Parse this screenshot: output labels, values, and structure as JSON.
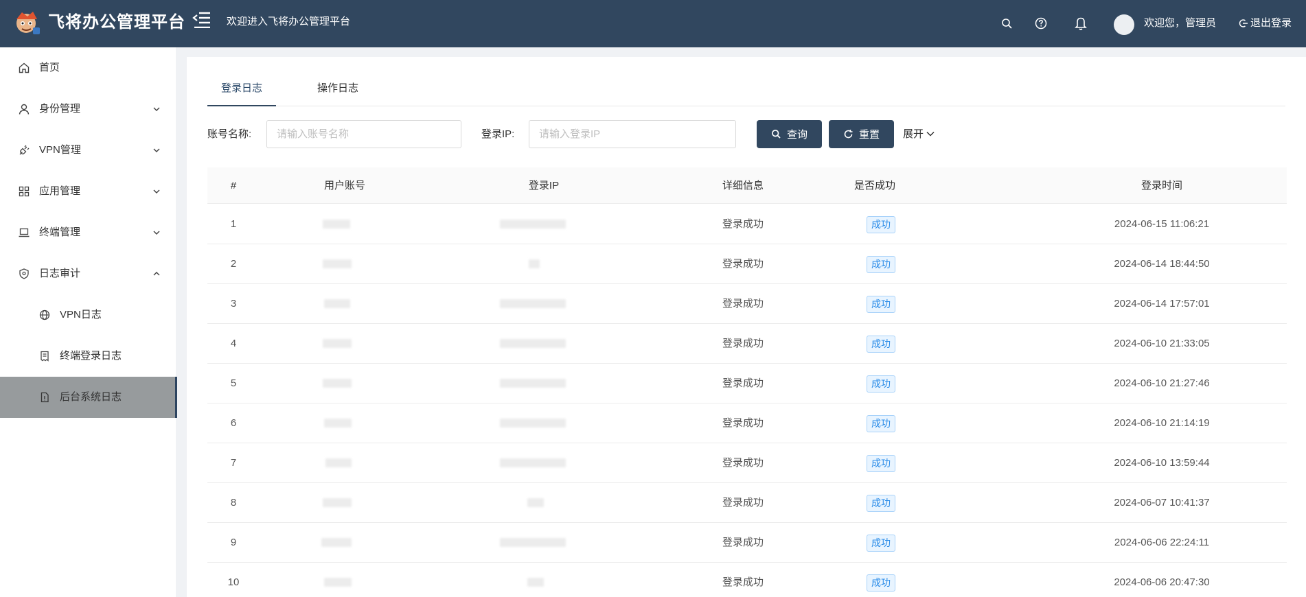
{
  "header": {
    "brand": "飞将办公管理平台",
    "welcome": "欢迎进入飞将办公管理平台",
    "user_greeting": "欢迎您，管理员",
    "logout_label": "退出登录",
    "bg_color": "#31475f"
  },
  "sidebar": {
    "items": [
      {
        "label": "首页",
        "icon": "home-icon"
      },
      {
        "label": "身份管理",
        "icon": "user-icon",
        "expandable": true,
        "expanded": false
      },
      {
        "label": "VPN管理",
        "icon": "plug-icon",
        "expandable": true,
        "expanded": false
      },
      {
        "label": "应用管理",
        "icon": "grid-icon",
        "expandable": true,
        "expanded": false
      },
      {
        "label": "终端管理",
        "icon": "laptop-icon",
        "expandable": true,
        "expanded": false
      },
      {
        "label": "日志审计",
        "icon": "shield-icon",
        "expandable": true,
        "expanded": true
      },
      {
        "label": "VPN日志",
        "icon": "globe-icon",
        "sub": true
      },
      {
        "label": "终端登录日志",
        "icon": "receipt-icon",
        "sub": true
      },
      {
        "label": "后台系统日志",
        "icon": "file-icon",
        "sub": true,
        "active": true
      }
    ]
  },
  "tabs": [
    "登录日志",
    "操作日志"
  ],
  "active_tab": "登录日志",
  "filters": {
    "account_label": "账号名称:",
    "account_placeholder": "请输入账号名称",
    "ip_label": "登录IP:",
    "ip_placeholder": "请输入登录IP",
    "search_label": "查询",
    "reset_label": "重置",
    "expand_label": "展开"
  },
  "table": {
    "columns": [
      "#",
      "用户账号",
      "登录IP",
      "详细信息",
      "是否成功",
      "登录时间"
    ],
    "rows": [
      {
        "idx": "1",
        "detail": "登录成功",
        "success": "成功",
        "time": "2024-06-15 11:06:21"
      },
      {
        "idx": "2",
        "detail": "登录成功",
        "success": "成功",
        "time": "2024-06-14 18:44:50"
      },
      {
        "idx": "3",
        "detail": "登录成功",
        "success": "成功",
        "time": "2024-06-14 17:57:01"
      },
      {
        "idx": "4",
        "detail": "登录成功",
        "success": "成功",
        "time": "2024-06-10 21:33:05"
      },
      {
        "idx": "5",
        "detail": "登录成功",
        "success": "成功",
        "time": "2024-06-10 21:27:46"
      },
      {
        "idx": "6",
        "detail": "登录成功",
        "success": "成功",
        "time": "2024-06-10 21:14:19"
      },
      {
        "idx": "7",
        "detail": "登录成功",
        "success": "成功",
        "time": "2024-06-10 13:59:44"
      },
      {
        "idx": "8",
        "detail": "登录成功",
        "success": "成功",
        "time": "2024-06-07 10:41:37"
      },
      {
        "idx": "9",
        "detail": "登录成功",
        "success": "成功",
        "time": "2024-06-06 22:24:11"
      },
      {
        "idx": "10",
        "detail": "登录成功",
        "success": "成功",
        "time": "2024-06-06 20:47:30"
      }
    ]
  }
}
